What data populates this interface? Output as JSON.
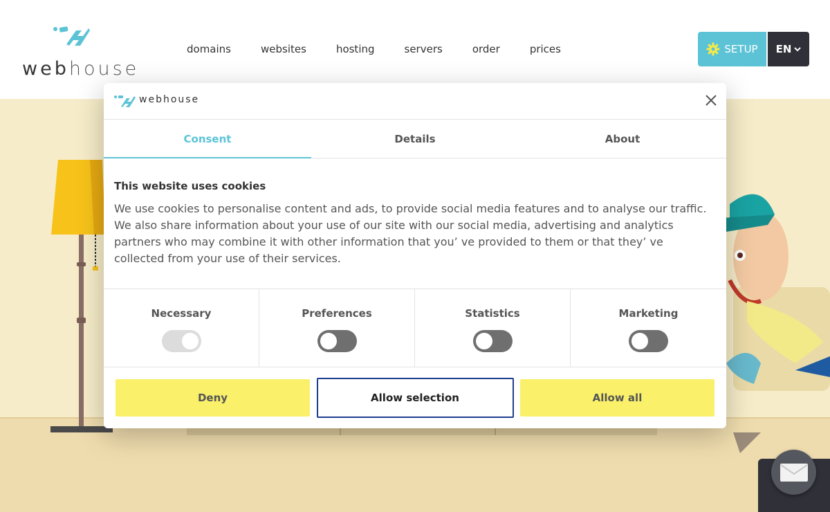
{
  "header": {
    "logo_text_bold": "web",
    "logo_text_thin": "house",
    "nav": [
      "domains",
      "websites",
      "hosting",
      "servers",
      "order",
      "prices"
    ],
    "setup_label": "SETUP",
    "language": "EN"
  },
  "modal": {
    "logo_text": "webhouse",
    "tabs": [
      "Consent",
      "Details",
      "About"
    ],
    "active_tab": "Consent",
    "heading": "This website uses cookies",
    "body": "We use cookies to personalise content and ads, to provide social media features and to analyse our traffic. We also share information about your use of our site with our social media, advertising and analytics partners who may combine it with other information that you’ ve provided to them or that they’ ve collected from your use of their services.",
    "toggles": [
      {
        "label": "Necessary",
        "on": true,
        "disabled": true
      },
      {
        "label": "Preferences",
        "on": false
      },
      {
        "label": "Statistics",
        "on": false
      },
      {
        "label": "Marketing",
        "on": false
      }
    ],
    "buttons": {
      "deny": "Deny",
      "allow_selection": "Allow selection",
      "allow_all": "Allow all"
    }
  },
  "colors": {
    "accent": "#5cc3d6",
    "button_yellow": "#faf06a",
    "dark": "#2f3038",
    "selection_border": "#1d3d8f"
  },
  "icons": [
    "gear-icon",
    "chevron-down-icon",
    "close-icon",
    "mail-icon"
  ]
}
